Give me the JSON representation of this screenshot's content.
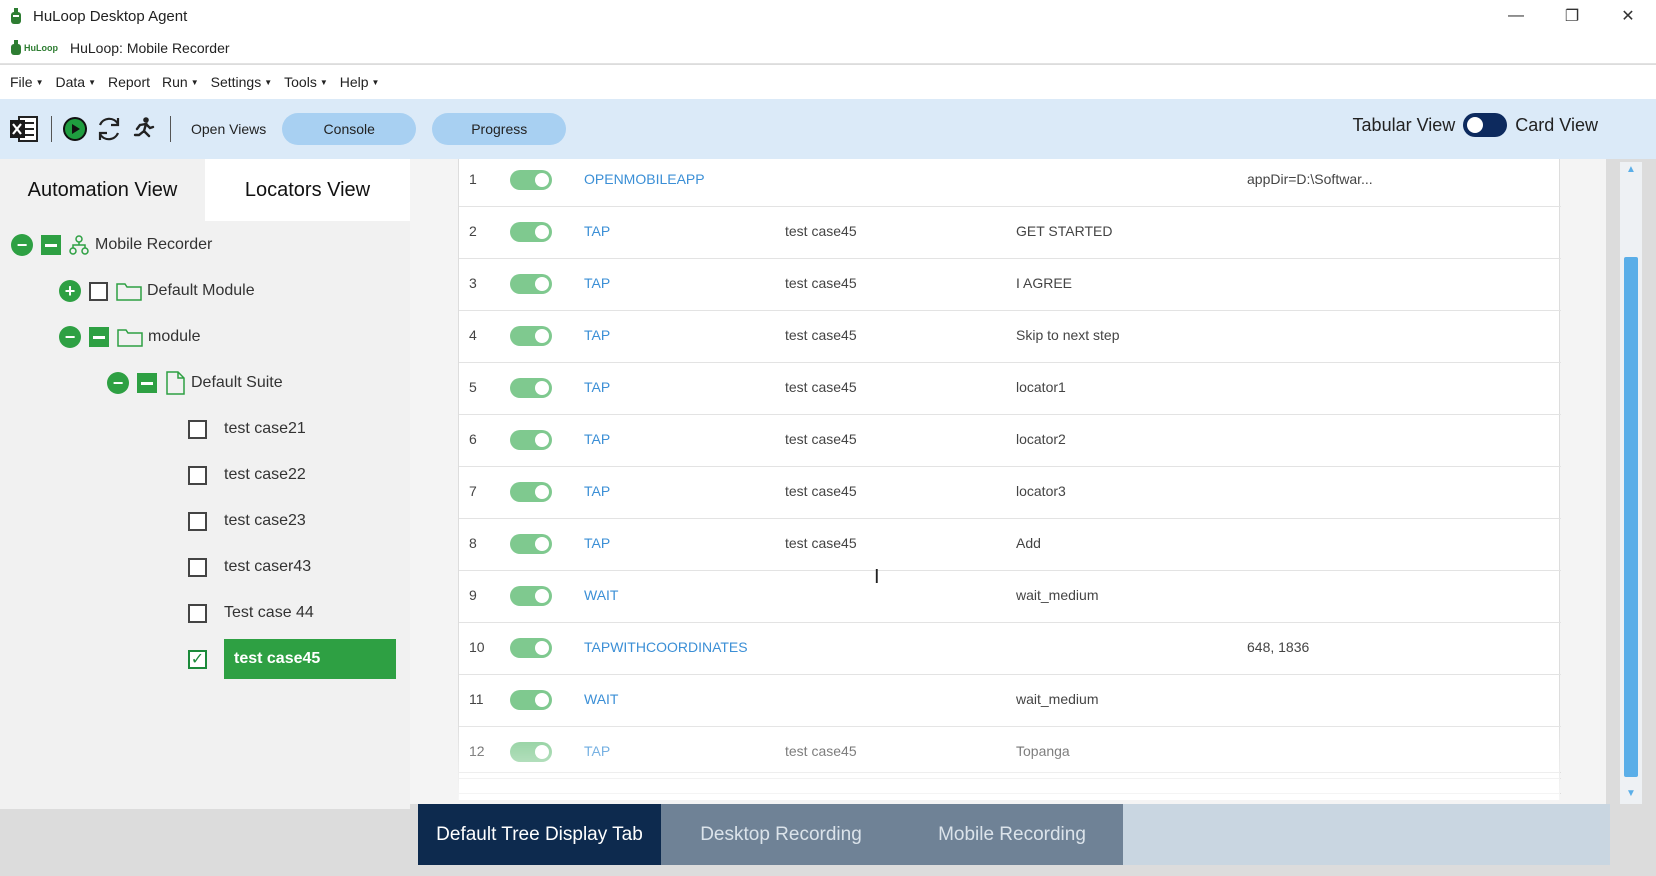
{
  "window": {
    "title": "HuLoop Desktop Agent",
    "subtitle": "HuLoop: Mobile Recorder",
    "logo_text": "HuLoop",
    "controls": {
      "minimize": "—",
      "restore": "❐",
      "close": "✕"
    }
  },
  "menu": [
    {
      "label": "File",
      "has_caret": true
    },
    {
      "label": "Data",
      "has_caret": true
    },
    {
      "label": "Report",
      "has_caret": false
    },
    {
      "label": "Run",
      "has_caret": true
    },
    {
      "label": "Settings",
      "has_caret": true
    },
    {
      "label": "Tools",
      "has_caret": true
    },
    {
      "label": "Help",
      "has_caret": true
    }
  ],
  "toolbar": {
    "open_views": "Open Views",
    "console": "Console",
    "progress": "Progress",
    "tabular_view": "Tabular View",
    "card_view": "Card View",
    "icons": [
      "excel-icon",
      "play-icon",
      "refresh-icon",
      "runner-icon"
    ]
  },
  "left_panel": {
    "tabs": [
      "Automation View",
      "Locators View"
    ],
    "active_tab": "Locators View",
    "tree": {
      "root": "Mobile Recorder",
      "modules": [
        "Default Module",
        "module"
      ],
      "suite": "Default Suite",
      "cases": [
        {
          "label": "test case21",
          "checked": false
        },
        {
          "label": "test case22",
          "checked": false
        },
        {
          "label": "test case23",
          "checked": false
        },
        {
          "label": "test caser43",
          "checked": false
        },
        {
          "label": "Test case 44",
          "checked": false
        },
        {
          "label": "test case45",
          "checked": true
        }
      ]
    }
  },
  "steps": [
    {
      "index": "1",
      "action": "OPENMOBILEAPP",
      "test_case": "",
      "locator": "",
      "value": "appDir=D:\\Softwar..."
    },
    {
      "index": "2",
      "action": "TAP",
      "test_case": "test case45",
      "locator": "GET STARTED",
      "value": ""
    },
    {
      "index": "3",
      "action": "TAP",
      "test_case": "test case45",
      "locator": "I AGREE",
      "value": ""
    },
    {
      "index": "4",
      "action": "TAP",
      "test_case": "test case45",
      "locator": "Skip to next step",
      "value": ""
    },
    {
      "index": "5",
      "action": "TAP",
      "test_case": "test case45",
      "locator": "locator1",
      "value": ""
    },
    {
      "index": "6",
      "action": "TAP",
      "test_case": "test case45",
      "locator": "locator2",
      "value": ""
    },
    {
      "index": "7",
      "action": "TAP",
      "test_case": "test case45",
      "locator": "locator3",
      "value": ""
    },
    {
      "index": "8",
      "action": "TAP",
      "test_case": "test case45",
      "locator": "Add",
      "value": ""
    },
    {
      "index": "9",
      "action": "WAIT",
      "test_case": "",
      "locator": "wait_medium",
      "value": ""
    },
    {
      "index": "10",
      "action": "TAPWITHCOORDINATES",
      "test_case": "",
      "locator": "",
      "value": "648, 1836"
    },
    {
      "index": "11",
      "action": "WAIT",
      "test_case": "",
      "locator": "wait_medium",
      "value": ""
    },
    {
      "index": "12",
      "action": "TAP",
      "test_case": "test case45",
      "locator": "Topanga",
      "value": ""
    }
  ],
  "bottom_tabs": [
    {
      "label": "Default Tree Display Tab",
      "active": true
    },
    {
      "label": "Desktop Recording",
      "active": false
    },
    {
      "label": "Mobile Recording",
      "active": false
    }
  ],
  "colors": {
    "accent_green": "#2ea043",
    "action_blue": "#3b8fd6",
    "toolbar_bg": "#dbeaf8",
    "pill_blue": "#a8d0f2",
    "active_tab_navy": "#0d2a4e"
  }
}
